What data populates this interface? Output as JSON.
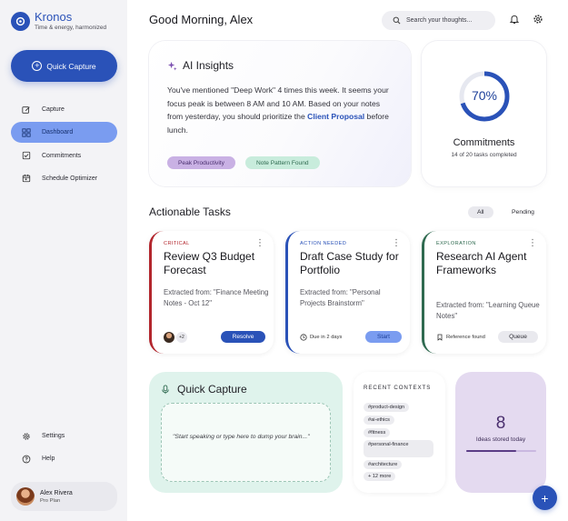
{
  "brand": {
    "name": "Kronos",
    "tagline": "Time & energy, harmonized"
  },
  "sidebar": {
    "quick_capture_label": "Quick Capture",
    "items": [
      {
        "label": "Capture",
        "icon": "edit-icon"
      },
      {
        "label": "Dashboard",
        "icon": "grid-icon",
        "active": true
      },
      {
        "label": "Commitments",
        "icon": "checkbox-icon"
      },
      {
        "label": "Schedule Optimizer",
        "icon": "calendar-icon"
      }
    ],
    "bottom_items": [
      {
        "label": "Settings",
        "icon": "gear-icon"
      },
      {
        "label": "Help",
        "icon": "help-icon"
      }
    ],
    "user": {
      "name": "Alex Rivera",
      "plan": "Pro Plan"
    }
  },
  "header": {
    "greeting": "Good Morning, Alex",
    "search_placeholder": "Search your thoughts...",
    "icons": [
      "bell-icon",
      "gear-icon"
    ]
  },
  "ai_insights": {
    "title": "AI Insights",
    "text_before": "You've mentioned \"Deep Work\" 4 times this week. It seems your focus peak is between 8 AM and 10 AM. Based on your notes from yesterday, you should prioritize the ",
    "highlight": "Client Proposal",
    "text_after": " before lunch.",
    "chips": [
      "Peak Productivity",
      "Note Pattern Found"
    ]
  },
  "commitments": {
    "percent_label": "70%",
    "progress": 0.7,
    "title": "Commitments",
    "subtitle": "14 of 20 tasks completed",
    "color": "#2a52b8"
  },
  "tasks": {
    "title": "Actionable Tasks",
    "filters": [
      "All",
      "Pending"
    ],
    "cards": [
      {
        "tag": "CRITICAL",
        "title": "Review Q3 Budget Forecast",
        "source": "Extracted from: \"Finance Meeting Notes - Oct 12\"",
        "extra_count": "+2",
        "action": "Resolve",
        "accent": "#b3262d"
      },
      {
        "tag": "ACTION NEEDED",
        "title": "Draft Case Study for Portfolio",
        "source": "Extracted from: \"Personal Projects Brainstorm\"",
        "meta": "Due in 2 days",
        "action": "Start",
        "accent": "#2a52b8"
      },
      {
        "tag": "EXPLORATION",
        "title": "Research AI Agent Frameworks",
        "source": "Extracted from: \"Learning Queue Notes\"",
        "meta": "Reference found",
        "action": "Queue",
        "accent": "#2f6a50"
      }
    ]
  },
  "quick_capture": {
    "title": "Quick Capture",
    "placeholder": "\"Start speaking or type here to dump your brain...\""
  },
  "recent_contexts": {
    "title": "RECENT CONTEXTS",
    "tags": [
      "#product-design",
      "#ai-ethics",
      "#fitness",
      "#personal-finance",
      "#architecture",
      "+ 12 more"
    ]
  },
  "ideas": {
    "count": "8",
    "label": "Ideas stored today",
    "progress": 0.72
  },
  "fab_label": "+"
}
